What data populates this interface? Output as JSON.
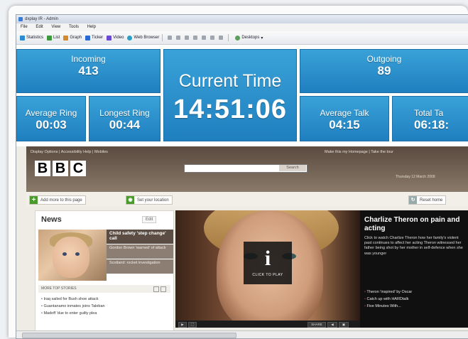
{
  "window": {
    "title": "dxplay IR - Admin",
    "menu": [
      "File",
      "Edit",
      "View",
      "Tools",
      "Help"
    ]
  },
  "toolbar": {
    "buttons": [
      {
        "label": "Statistics",
        "icon": "statistics-icon",
        "color": "#2a8ad4"
      },
      {
        "label": "List",
        "icon": "list-icon",
        "color": "#3a9a3a"
      },
      {
        "label": "Graph",
        "icon": "graph-icon",
        "color": "#d48a2a"
      },
      {
        "label": "Ticker",
        "icon": "ticker-icon",
        "color": "#2a6ad4"
      },
      {
        "label": "Video",
        "icon": "video-icon",
        "color": "#6a4ad4"
      },
      {
        "label": "Web Browser",
        "icon": "globe-icon",
        "color": "#2aa0c8"
      }
    ],
    "desktops_label": "Desktops"
  },
  "dashboard": {
    "incoming": {
      "label": "Incoming",
      "value": "413"
    },
    "outgoing": {
      "label": "Outgoing",
      "value": "89"
    },
    "average_ring": {
      "label": "Average Ring",
      "value": "00:03"
    },
    "longest_ring": {
      "label": "Longest Ring",
      "value": "00:44"
    },
    "current_time": {
      "label": "Current Time",
      "value": "14:51:06"
    },
    "average_talk": {
      "label": "Average Talk",
      "value": "04:15"
    },
    "total_talk": {
      "label": "Total Ta",
      "value": "06:18:"
    },
    "colors": {
      "tile_top": "#3aa2d8",
      "tile_bottom": "#1f7fbf"
    }
  },
  "bbc": {
    "top_links": "Display Options  |  Accessibility Help  |  Mobiles",
    "top_right": "Make this my Homepage  |  Take the tour",
    "logo_letters": [
      "B",
      "B",
      "C"
    ],
    "search_button": "Search",
    "date": "Thursday 12 March 2009",
    "add_more": "Add more to this page",
    "set_location": "Set your location",
    "reset": "Reset home",
    "news": {
      "title": "News",
      "edit": "Edit",
      "headlines": [
        "Child safety 'step change' call",
        "Gordon Brown 'warned' of attack",
        "Scotland: rocket investigation"
      ],
      "more_label": "MORE TOP STORIES",
      "stories": [
        "Iraq sailed for Bush shoe attack",
        "Guantanamo inmates joins Taleban",
        "Madoff 'due to enter guilty plea"
      ]
    },
    "video": {
      "play_label": "CLICK TO PLAY",
      "share_label": "SHARE"
    },
    "feature": {
      "title": "Charlize Theron on pain and acting",
      "description": "Click to watch Charlize Theron how her family's violent past continues to affect her acting Theron witnessed her father being shot by her mother in self-defence when she was younger",
      "bullets": [
        "Theron 'inspired' by Oscar",
        "Catch up with HARDtalk",
        "Five Minutes With..."
      ]
    }
  }
}
